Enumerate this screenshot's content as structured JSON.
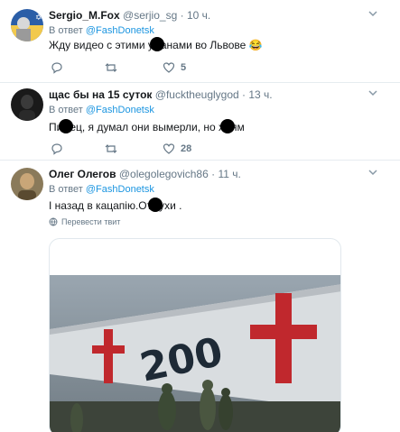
{
  "tweets": [
    {
      "name": "Sergio_M.Fox",
      "handle": "@serjio_sg",
      "dot": "·",
      "time": "10 ч.",
      "reply_prefix": "В ответ",
      "reply_to": "@FashDonetsk",
      "text_a": "Жду видео с этими у",
      "text_b": "анами во Львове 😂",
      "likes": "5"
    },
    {
      "name": "щас бы на 15 суток",
      "handle": "@fucktheuglygod",
      "dot": "·",
      "time": "13 ч.",
      "reply_prefix": "В ответ",
      "reply_to": "@FashDonetsk",
      "text_a": "Пи",
      "text_b": "ец, я думал они вымерли, но х",
      "text_c": "ям",
      "likes": "28"
    },
    {
      "name": "Олег Олегов",
      "handle": "@olegolegovich86",
      "dot": "·",
      "time": "11 ч.",
      "reply_prefix": "В ответ",
      "reply_to": "@FashDonetsk",
      "text_a": "І назад в кацапію.От",
      "text_b": "ухи .",
      "translate": "Перевести твит",
      "card_label": "200"
    }
  ],
  "colors": {
    "link": "#1b95e0",
    "muted": "#657786",
    "divider": "#e6ecf0"
  },
  "icons": [
    "chevron-down-icon",
    "reply-icon",
    "retweet-icon",
    "like-icon",
    "globe-icon"
  ]
}
